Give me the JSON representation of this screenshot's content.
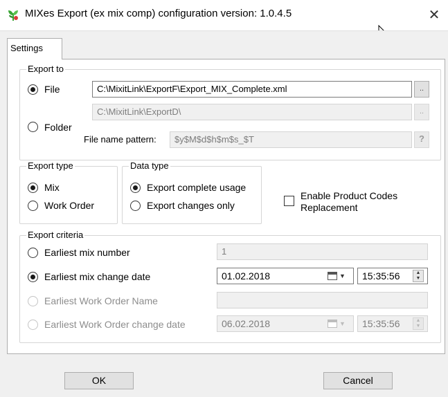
{
  "window": {
    "title": "MIXes Export (ex mix comp) configuration version: 1.0.4.5",
    "close_glyph": "✕"
  },
  "tabs": [
    {
      "label": "Settings"
    }
  ],
  "export_to": {
    "legend": "Export to",
    "file_label": "File",
    "file_checked": true,
    "file_path": "C:\\MixitLink\\ExportF\\Export_MIX_Complete.xml",
    "folder_label": "Folder",
    "folder_checked": false,
    "folder_path": "C:\\MixitLink\\ExportD\\",
    "browse_label": "..",
    "pattern_label": "File name pattern:",
    "pattern_value": "$y$M$d$h$m$s_$T",
    "help_label": "?"
  },
  "export_type": {
    "legend": "Export type",
    "options": [
      {
        "label": "Mix",
        "checked": true
      },
      {
        "label": "Work Order",
        "checked": false
      }
    ]
  },
  "data_type": {
    "legend": "Data type",
    "options": [
      {
        "label": "Export complete usage",
        "checked": true
      },
      {
        "label": "Export changes only",
        "checked": false
      }
    ]
  },
  "product_codes": {
    "label_line1": "Enable Product Codes",
    "label_line2": "Replacement",
    "checked": false
  },
  "export_criteria": {
    "legend": "Export criteria",
    "earliest_mix_number": {
      "label": "Earliest mix number",
      "value": "1"
    },
    "earliest_mix_change_date": {
      "label": "Earliest mix change date",
      "date": "01.02.2018",
      "time": "15:35:56"
    },
    "earliest_wo_name": {
      "label": "Earliest Work Order Name",
      "value": ""
    },
    "earliest_wo_change_date": {
      "label": "Earliest Work Order change date",
      "date": "06.02.2018",
      "time": "15:35:56"
    }
  },
  "buttons": {
    "ok": "OK",
    "cancel": "Cancel"
  },
  "colors": {
    "icon_green": "#3aa635",
    "icon_red": "#d83b3b"
  }
}
